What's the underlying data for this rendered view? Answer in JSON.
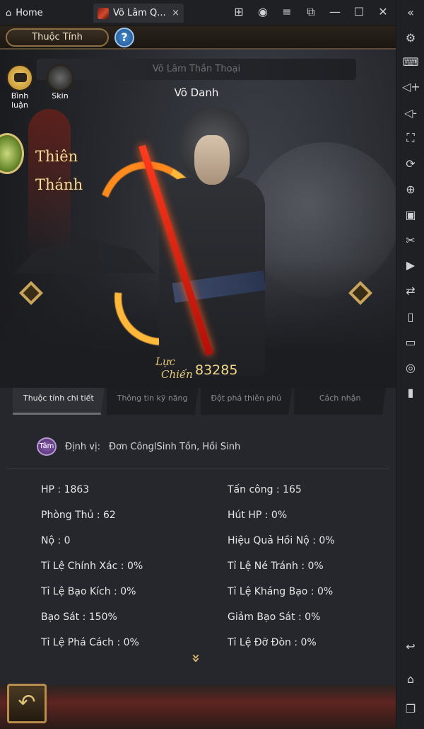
{
  "emulator": {
    "home_tab": "Home",
    "game_tab": "Võ Lâm Q...",
    "tab_close": "×",
    "window_controls": [
      "gamepad-icon",
      "account-icon",
      "menu-icon",
      "external-icon",
      "minimize-icon",
      "maximize-icon",
      "close-icon",
      "collapse-icon"
    ],
    "sidebar_icons": [
      "settings-icon",
      "keyboard-icon",
      "volume-up-icon",
      "volume-down-icon",
      "fullscreen-icon",
      "rotate-icon",
      "add-app-icon",
      "apk-icon",
      "scissors-icon",
      "record-icon",
      "transfer-icon",
      "shake-icon",
      "folder-icon",
      "location-icon",
      "vibrate-icon",
      "back-icon",
      "home-icon",
      "recent-apps-icon"
    ]
  },
  "header": {
    "tab_label": "Thuộc Tính",
    "help_label": "?"
  },
  "character": {
    "banner": "Võ Lâm Thần Thoại",
    "name": "Võ Danh",
    "comment_label": "Bình luận",
    "skin_label": "Skin",
    "rank_line1": "Thiên",
    "rank_line2": "Thánh",
    "power_label_1": "Lực",
    "power_label_2": "Chiến",
    "power_value": "83285"
  },
  "tabs": [
    {
      "label": "Thuộc tính chi tiết",
      "active": true
    },
    {
      "label": "Thông tin kỹ năng",
      "active": false
    },
    {
      "label": "Đột phá thiên phú",
      "active": false
    },
    {
      "label": "Cách nhận",
      "active": false
    }
  ],
  "role": {
    "badge": "Tâm",
    "label": "Định vị:",
    "value": "Đơn CônglSinh Tồn, Hồi Sinh"
  },
  "stats": [
    "HP : 1863",
    "Tấn công : 165",
    "Phòng Thủ : 62",
    "Hút HP : 0%",
    "Nộ : 0",
    "Hiệu Quả Hồi Nộ : 0%",
    "Tỉ Lệ Chính Xác : 0%",
    "Tỉ Lệ Né Tránh : 0%",
    "Tỉ Lệ Bạo Kích : 0%",
    "Tỉ Lệ Kháng Bạo : 0%",
    "Bạo Sát : 150%",
    "Giảm Bạo Sát : 0%",
    "Tỉ Lệ Phá Cách : 0%",
    "Tỉ Lệ Đỡ Đòn : 0%"
  ],
  "more_arrow": "»",
  "back_button": "↶"
}
